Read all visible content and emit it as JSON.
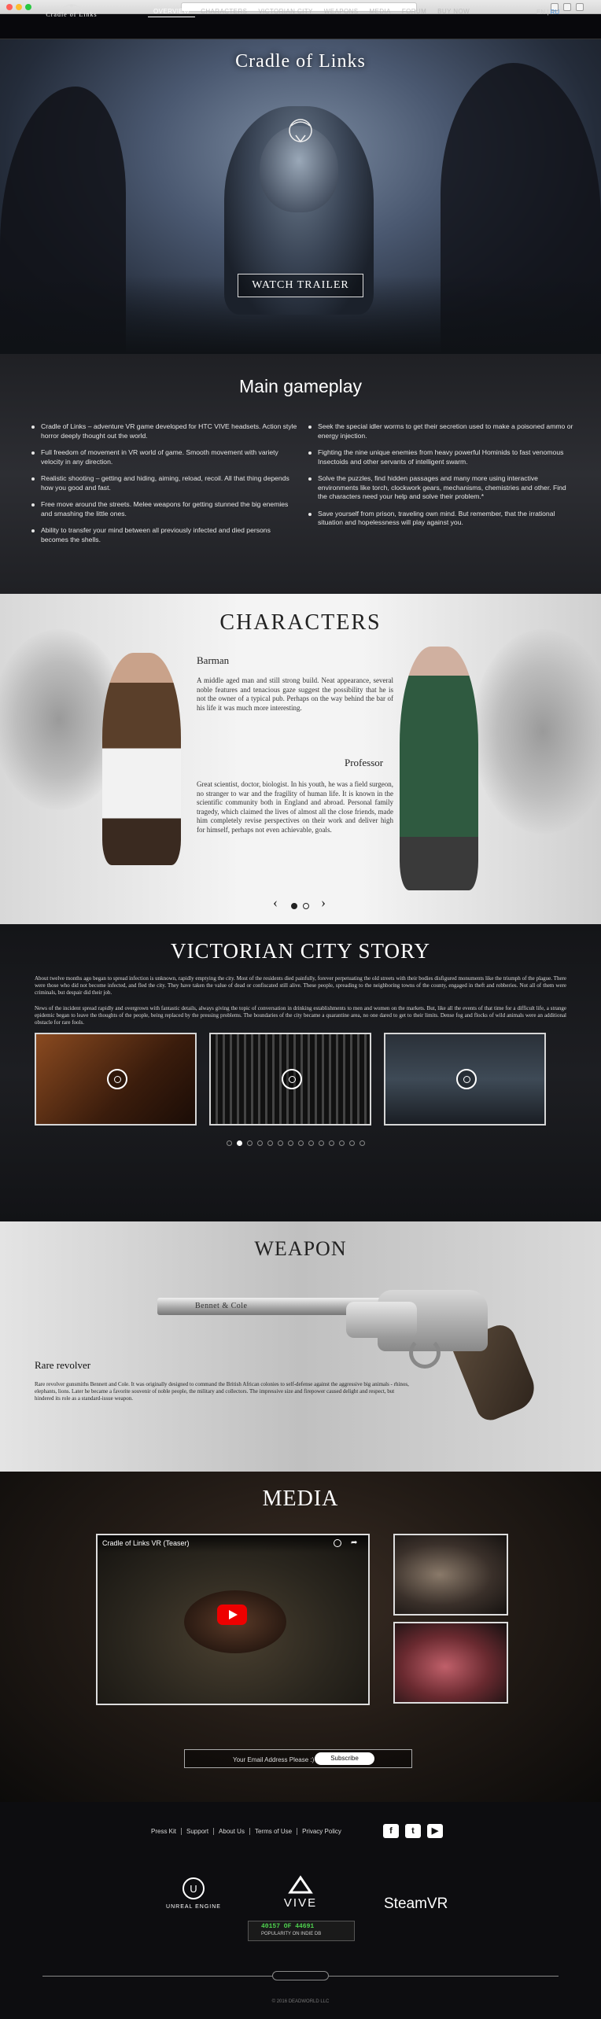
{
  "nav": {
    "logo": "Cradle of Links",
    "links": [
      "OVERVIEW",
      "CHARACTERS",
      "VICTORIAN CITY",
      "WEAPONS",
      "MEDIA",
      "FORUM",
      "BUY NOW"
    ],
    "lang_en": "EN",
    "lang_ru": "RU"
  },
  "hero": {
    "title": "Cradle of Links",
    "trailer_button": "WATCH TRAILER"
  },
  "gameplay": {
    "title": "Main gameplay",
    "left": [
      "Cradle of Links – adventure VR game developed for HTC VIVE headsets. Action style horror deeply thought out the world.",
      "Full freedom of movement in VR world of game. Smooth movement with variety velocity in any direction.",
      "Realistic shooting – getting and hiding, aiming, reload, recoil. All that thing depends how you good and fast.",
      "Free move around the streets. Melee weapons for getting stunned the big enemies and smashing the little ones.",
      "Ability to transfer your mind between all previously infected and died persons becomes the shells."
    ],
    "right": [
      "Seek the special idler worms to get their secretion used to make a poisoned ammo or energy injection.",
      "Fighting the nine unique enemies from heavy powerful Hominids to fast venomous Insectoids and other servants of intelligent swarm.",
      "Solve the puzzles, find hidden passages and many more using interactive environments like torch, clockwork gears, mechanisms, chemistries and other. Find the characters need your help and solve their problem.*",
      "Save yourself from prison, traveling own mind. But remember, that the irrational situation and hopelessness will play against you."
    ]
  },
  "characters": {
    "title": "CHARACTERS",
    "barman_name": "Barman",
    "barman_text": "A middle aged man and still strong build. Neat appearance, several noble features and tenacious gaze suggest the possibility that he is not the owner of a typical pub. Perhaps on the way behind the bar of his life it was much more interesting.",
    "professor_name": "Professor",
    "professor_text": "Great scientist, doctor, biologist. In his youth, he was a field surgeon, no stranger to war and the fragility of human life. It is known in the scientific community both in England and abroad. Personal family tragedy, which claimed the lives of almost all the close friends, made him completely revise perspectives on their work and deliver high for himself, perhaps not even achievable, goals.",
    "prev": "‹",
    "next": "›"
  },
  "victorian": {
    "title": "VICTORIAN CITY STORY",
    "para1": "About twelve months ago began to spread infection is unknown, rapidly emptying the city. Most of the residents died painfully, forever perpetuating the old streets with their bodies disfigured monuments like the triumph of the plague. There were those who did not become infected, and fled the city. They have taken the value of dead or confiscated still alive. These people, spreading to the neighboring towns of the county, engaged in theft and robberies. Not all of them were criminals, but despair did their job.",
    "para2": "News of the incident spread rapidly and overgrown with fantastic details, always giving the topic of conversation in drinking establishments to men and women on the markets. But, like all the events of that time for a difficult life, a strange epidemic began to leave the thoughts of the people, being replaced by the pressing problems. The boundaries of the city became a quarantine area, no one dared to get to their limits. Dense fog and flocks of wild animals were an additional obstacle for rare fools."
  },
  "weapon": {
    "title": "WEAPON",
    "engraving": "Bennet & Cole",
    "subtitle": "Rare revolver",
    "text": "Rare revolver gunsmiths Bennett and Cole. It was originally designed to command the British African colonies to self-defense against the aggressive big animals - rhinos, elephants, lions. Later he became a favorite souvenir of noble people, the military and collectors. The impressive size and firepower caused delight and respect, but hindered its role as a standard-issue weapon."
  },
  "media": {
    "title": "MEDIA",
    "video_title": "Cradle of Links VR (Teaser)",
    "subscribe_label": "Your Email Address Please :)",
    "subscribe_button": "Subscribe"
  },
  "footer": {
    "links": [
      "Press Kit",
      "Support",
      "About Us",
      "Terms of Use",
      "Privacy Policy"
    ],
    "social": [
      "f",
      "t",
      "▶"
    ],
    "partners": [
      "UNREAL ENGINE",
      "VIVE",
      "SteamVR"
    ],
    "indie_rank": "40157 OF 44691",
    "indie_sub": "POPULARITY ON INDIE DB",
    "copyright": "© 2016 DEADWORLD LLC"
  },
  "colors": {
    "accent_lang": "#4a8fd8",
    "indie_green": "#4fd34f",
    "youtube_red": "#e00000"
  },
  "icons": [
    "zoom-icon",
    "clock-icon",
    "share-icon",
    "youtube-play-icon",
    "facebook-icon",
    "twitter-icon",
    "youtube-icon"
  ]
}
